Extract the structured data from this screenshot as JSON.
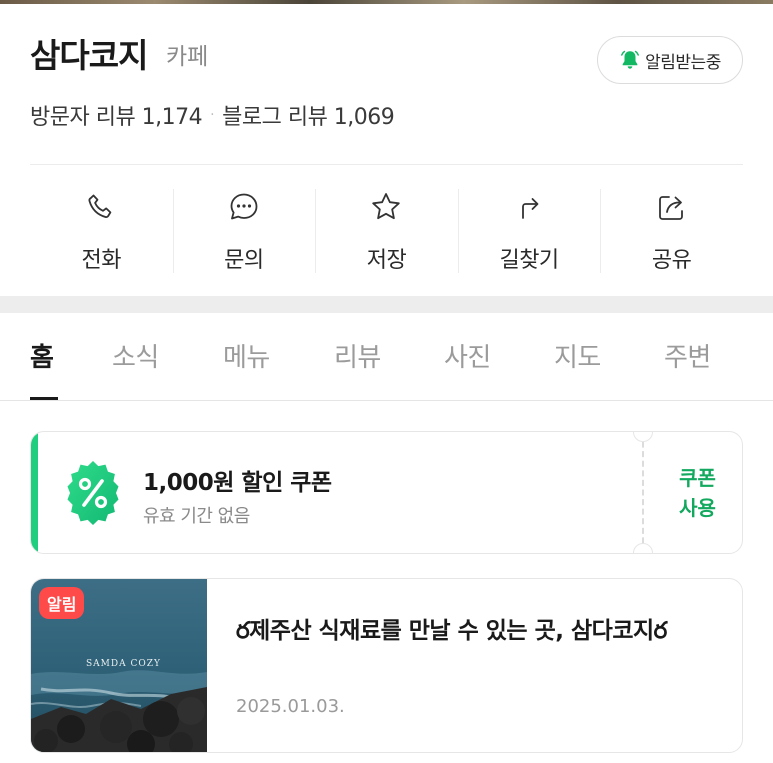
{
  "place": {
    "name": "삼다코지",
    "category": "카페",
    "notify_label": "알림받는중",
    "visitor_review_label": "방문자 리뷰 1,174",
    "separator": "·",
    "blog_review_label": "블로그 리뷰 1,069"
  },
  "actions": [
    {
      "icon": "phone-icon",
      "label": "전화"
    },
    {
      "icon": "chat-bubble-icon",
      "label": "문의"
    },
    {
      "icon": "star-icon",
      "label": "저장"
    },
    {
      "icon": "directions-arrow-icon",
      "label": "길찾기"
    },
    {
      "icon": "share-icon",
      "label": "공유"
    }
  ],
  "tabs": [
    {
      "label": "홈",
      "active": true
    },
    {
      "label": "소식",
      "active": false
    },
    {
      "label": "메뉴",
      "active": false
    },
    {
      "label": "리뷰",
      "active": false
    },
    {
      "label": "사진",
      "active": false
    },
    {
      "label": "지도",
      "active": false
    },
    {
      "label": "주변",
      "active": false
    }
  ],
  "coupon": {
    "title": "1,000원 할인 쿠폰",
    "subtitle": "유효 기간 없음",
    "use_line1": "쿠폰",
    "use_line2": "사용",
    "accent_color": "#1fcf7f"
  },
  "news": {
    "tag": "알림",
    "thumbnail_text": "SAMDA COZY",
    "title": "ర제주산 식재료를 만날 수 있는 곳, 삼다코지ర",
    "date": "2025.01.03."
  }
}
